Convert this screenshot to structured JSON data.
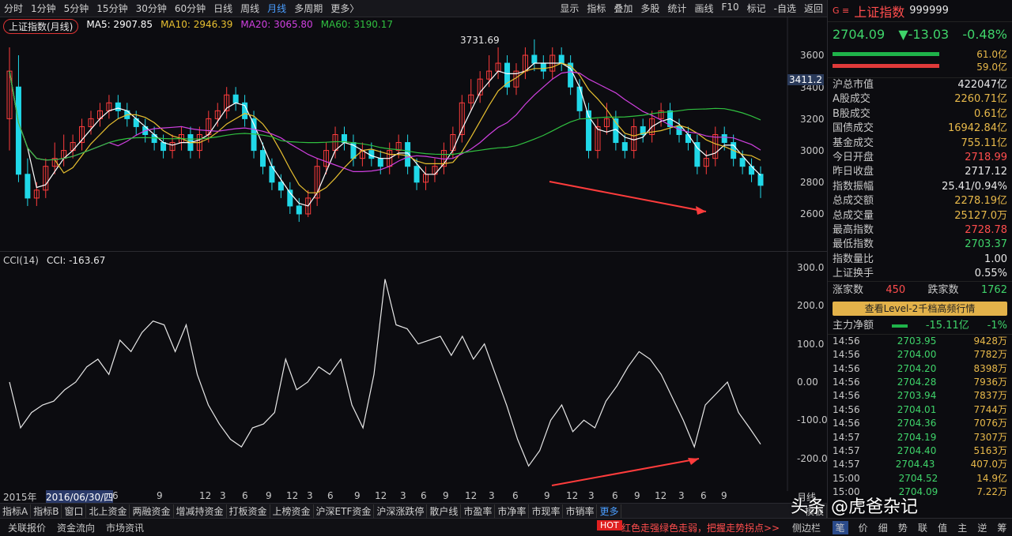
{
  "toolbar": {
    "periods": [
      "分时",
      "1分钟",
      "5分钟",
      "15分钟",
      "30分钟",
      "60分钟",
      "日线",
      "周线",
      "月线",
      "多周期",
      "更多〉"
    ],
    "active": "月线",
    "tools": [
      "显示",
      "指标",
      "叠加",
      "多股",
      "统计",
      "画线",
      "F10",
      "标记",
      "-自选",
      "返回"
    ]
  },
  "chart": {
    "title": "上证指数(月线)",
    "ma5": "MA5: 2907.85",
    "ma10": "MA10: 2946.39",
    "ma20": "MA20: 3065.80",
    "ma60": "MA60: 3190.17",
    "high_label": "3731.69",
    "cursor_price": "3411.2",
    "yticks": [
      "3600",
      "3400",
      "3200",
      "3000",
      "2800",
      "2600"
    ],
    "ma_colors": {
      "ma5": "#ffffff",
      "ma10": "#e8c030",
      "ma20": "#d040e0",
      "ma60": "#30c040"
    },
    "up_color": "#ff3c3c",
    "down_color": "#20d8e8"
  },
  "cci": {
    "title": "CCI(14)",
    "value": "CCI: -163.67",
    "yticks": [
      "300.0",
      "200.0",
      "100.0",
      "0.00",
      "-100.0",
      "-200.0"
    ]
  },
  "xaxis": {
    "labels": [
      "2015年",
      "2016/06/30/四",
      "6",
      "9",
      "12",
      "3",
      "6",
      "9",
      "12",
      "3",
      "6",
      "9",
      "12",
      "3",
      "6",
      "9",
      "12",
      "3",
      "6",
      "9",
      "12",
      "3",
      "6",
      "9",
      "12",
      "3",
      "6",
      "9"
    ],
    "right": "月线"
  },
  "bottom_tabs": [
    "指标A",
    "指标B",
    "窗口",
    "北上资金",
    "两融资金",
    "增减持资金",
    "打板资金",
    "上榜资金",
    "沪深ETF资金",
    "沪深涨跌停",
    "散户线",
    "市盈率",
    "市净率",
    "市现率",
    "市销率",
    "更多"
  ],
  "template": "模板",
  "bottombar": {
    "items": [
      "关联报价",
      "资金流向",
      "市场资讯"
    ],
    "hot": "HOT",
    "hot_text": "红色走强绿色走弱，把握走势拐点>>",
    "side": "侧边栏"
  },
  "quote": {
    "name": "上证指数",
    "code": "999999",
    "price": "2704.09",
    "change": "▼-13.03",
    "pct": "-0.48%",
    "bar1": "61.0亿",
    "bar2": "59.0亿",
    "rows": [
      [
        "沪总市值",
        "422047亿",
        "white"
      ],
      [
        "A股成交",
        "2260.71亿",
        "yellow"
      ],
      [
        "B股成交",
        "0.61亿",
        "yellow"
      ],
      [
        "国债成交",
        "16942.84亿",
        "yellow"
      ],
      [
        "基金成交",
        "755.11亿",
        "yellow"
      ],
      [
        "今日开盘",
        "2718.99",
        "red"
      ],
      [
        "昨日收盘",
        "2717.12",
        "white"
      ],
      [
        "指数振幅",
        "25.41/0.94%",
        "white"
      ],
      [
        "总成交额",
        "2278.19亿",
        "yellow"
      ],
      [
        "总成交量",
        "25127.0万",
        "yellow"
      ],
      [
        "最高指数",
        "2728.78",
        "red"
      ],
      [
        "最低指数",
        "2703.37",
        "green"
      ],
      [
        "指数量比",
        "1.00",
        "white"
      ],
      [
        "上证换手",
        "0.55%",
        "white"
      ]
    ],
    "up_label": "涨家数",
    "up": "450",
    "down_label": "跌家数",
    "down": "1762",
    "level2": "查看Level-2千档高频行情",
    "flow_label": "主力净额",
    "flow": "-15.11亿",
    "flow_pct": "-1%",
    "ticks": [
      [
        "14:56",
        "2703.95",
        "9428万"
      ],
      [
        "14:56",
        "2704.00",
        "7782万"
      ],
      [
        "14:56",
        "2704.20",
        "8398万"
      ],
      [
        "14:56",
        "2704.28",
        "7936万"
      ],
      [
        "14:56",
        "2703.94",
        "7837万"
      ],
      [
        "14:56",
        "2704.01",
        "7744万"
      ],
      [
        "14:56",
        "2704.36",
        "7076万"
      ],
      [
        "14:57",
        "2704.19",
        "7307万"
      ],
      [
        "14:57",
        "2704.40",
        "5163万"
      ],
      [
        "14:57",
        "2704.43",
        "407.0万"
      ],
      [
        "15:00",
        "2704.52",
        "14.9亿"
      ],
      [
        "15:00",
        "2704.09",
        "7.22万"
      ]
    ],
    "tabs": [
      "笔",
      "价",
      "细",
      "势",
      "联",
      "值",
      "主",
      "逆",
      "筹"
    ]
  },
  "watermark": "头条 @虎爸杂记"
}
